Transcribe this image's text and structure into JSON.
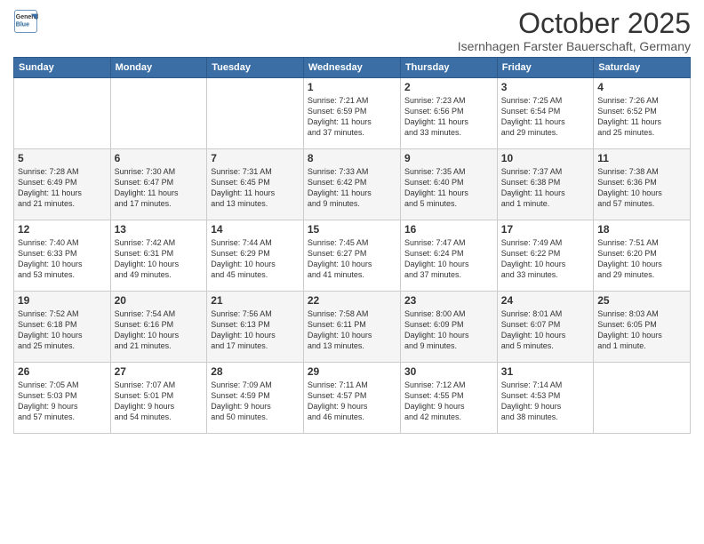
{
  "logo": {
    "general": "General",
    "blue": "Blue"
  },
  "title": {
    "month": "October 2025",
    "location": "Isernhagen Farster Bauerschaft, Germany"
  },
  "headers": [
    "Sunday",
    "Monday",
    "Tuesday",
    "Wednesday",
    "Thursday",
    "Friday",
    "Saturday"
  ],
  "weeks": [
    [
      {
        "day": "",
        "detail": ""
      },
      {
        "day": "",
        "detail": ""
      },
      {
        "day": "",
        "detail": ""
      },
      {
        "day": "1",
        "detail": "Sunrise: 7:21 AM\nSunset: 6:59 PM\nDaylight: 11 hours\nand 37 minutes."
      },
      {
        "day": "2",
        "detail": "Sunrise: 7:23 AM\nSunset: 6:56 PM\nDaylight: 11 hours\nand 33 minutes."
      },
      {
        "day": "3",
        "detail": "Sunrise: 7:25 AM\nSunset: 6:54 PM\nDaylight: 11 hours\nand 29 minutes."
      },
      {
        "day": "4",
        "detail": "Sunrise: 7:26 AM\nSunset: 6:52 PM\nDaylight: 11 hours\nand 25 minutes."
      }
    ],
    [
      {
        "day": "5",
        "detail": "Sunrise: 7:28 AM\nSunset: 6:49 PM\nDaylight: 11 hours\nand 21 minutes."
      },
      {
        "day": "6",
        "detail": "Sunrise: 7:30 AM\nSunset: 6:47 PM\nDaylight: 11 hours\nand 17 minutes."
      },
      {
        "day": "7",
        "detail": "Sunrise: 7:31 AM\nSunset: 6:45 PM\nDaylight: 11 hours\nand 13 minutes."
      },
      {
        "day": "8",
        "detail": "Sunrise: 7:33 AM\nSunset: 6:42 PM\nDaylight: 11 hours\nand 9 minutes."
      },
      {
        "day": "9",
        "detail": "Sunrise: 7:35 AM\nSunset: 6:40 PM\nDaylight: 11 hours\nand 5 minutes."
      },
      {
        "day": "10",
        "detail": "Sunrise: 7:37 AM\nSunset: 6:38 PM\nDaylight: 11 hours\nand 1 minute."
      },
      {
        "day": "11",
        "detail": "Sunrise: 7:38 AM\nSunset: 6:36 PM\nDaylight: 10 hours\nand 57 minutes."
      }
    ],
    [
      {
        "day": "12",
        "detail": "Sunrise: 7:40 AM\nSunset: 6:33 PM\nDaylight: 10 hours\nand 53 minutes."
      },
      {
        "day": "13",
        "detail": "Sunrise: 7:42 AM\nSunset: 6:31 PM\nDaylight: 10 hours\nand 49 minutes."
      },
      {
        "day": "14",
        "detail": "Sunrise: 7:44 AM\nSunset: 6:29 PM\nDaylight: 10 hours\nand 45 minutes."
      },
      {
        "day": "15",
        "detail": "Sunrise: 7:45 AM\nSunset: 6:27 PM\nDaylight: 10 hours\nand 41 minutes."
      },
      {
        "day": "16",
        "detail": "Sunrise: 7:47 AM\nSunset: 6:24 PM\nDaylight: 10 hours\nand 37 minutes."
      },
      {
        "day": "17",
        "detail": "Sunrise: 7:49 AM\nSunset: 6:22 PM\nDaylight: 10 hours\nand 33 minutes."
      },
      {
        "day": "18",
        "detail": "Sunrise: 7:51 AM\nSunset: 6:20 PM\nDaylight: 10 hours\nand 29 minutes."
      }
    ],
    [
      {
        "day": "19",
        "detail": "Sunrise: 7:52 AM\nSunset: 6:18 PM\nDaylight: 10 hours\nand 25 minutes."
      },
      {
        "day": "20",
        "detail": "Sunrise: 7:54 AM\nSunset: 6:16 PM\nDaylight: 10 hours\nand 21 minutes."
      },
      {
        "day": "21",
        "detail": "Sunrise: 7:56 AM\nSunset: 6:13 PM\nDaylight: 10 hours\nand 17 minutes."
      },
      {
        "day": "22",
        "detail": "Sunrise: 7:58 AM\nSunset: 6:11 PM\nDaylight: 10 hours\nand 13 minutes."
      },
      {
        "day": "23",
        "detail": "Sunrise: 8:00 AM\nSunset: 6:09 PM\nDaylight: 10 hours\nand 9 minutes."
      },
      {
        "day": "24",
        "detail": "Sunrise: 8:01 AM\nSunset: 6:07 PM\nDaylight: 10 hours\nand 5 minutes."
      },
      {
        "day": "25",
        "detail": "Sunrise: 8:03 AM\nSunset: 6:05 PM\nDaylight: 10 hours\nand 1 minute."
      }
    ],
    [
      {
        "day": "26",
        "detail": "Sunrise: 7:05 AM\nSunset: 5:03 PM\nDaylight: 9 hours\nand 57 minutes."
      },
      {
        "day": "27",
        "detail": "Sunrise: 7:07 AM\nSunset: 5:01 PM\nDaylight: 9 hours\nand 54 minutes."
      },
      {
        "day": "28",
        "detail": "Sunrise: 7:09 AM\nSunset: 4:59 PM\nDaylight: 9 hours\nand 50 minutes."
      },
      {
        "day": "29",
        "detail": "Sunrise: 7:11 AM\nSunset: 4:57 PM\nDaylight: 9 hours\nand 46 minutes."
      },
      {
        "day": "30",
        "detail": "Sunrise: 7:12 AM\nSunset: 4:55 PM\nDaylight: 9 hours\nand 42 minutes."
      },
      {
        "day": "31",
        "detail": "Sunrise: 7:14 AM\nSunset: 4:53 PM\nDaylight: 9 hours\nand 38 minutes."
      },
      {
        "day": "",
        "detail": ""
      }
    ]
  ]
}
